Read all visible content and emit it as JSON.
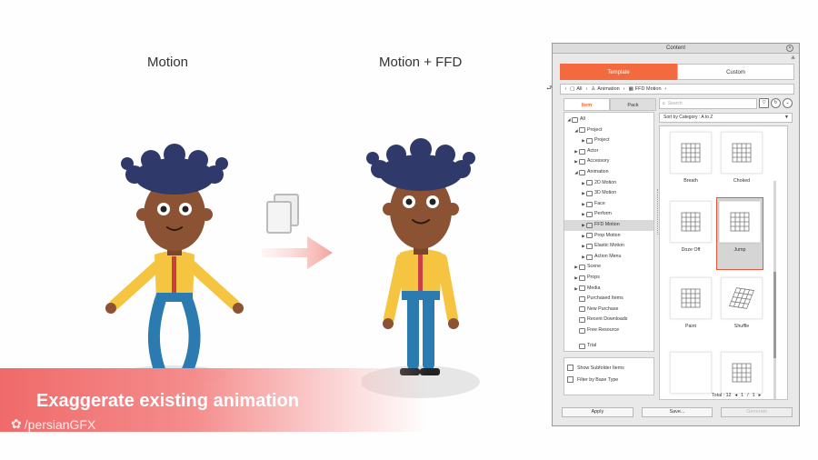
{
  "scene": {
    "caption_left": "Motion",
    "caption_right": "Motion + FFD",
    "banner_text": "Exaggerate existing animation",
    "watermark": "/persianGFX",
    "colors": {
      "accent": "#f26a3d",
      "banner": "#f06a6a",
      "shirt": "#f5c542",
      "pants": "#2b7bb0",
      "skin": "#8b5234",
      "hair": "#2f3a6b"
    }
  },
  "panel": {
    "title": "Content",
    "tabs": [
      "Template",
      "Custom"
    ],
    "active_tab": "Template",
    "breadcrumb": [
      "All",
      "Animation",
      "FFD Motion"
    ],
    "left_tabs": [
      "Item",
      "Pack"
    ],
    "tree": [
      {
        "label": "All",
        "level": 0,
        "toggle": "◢"
      },
      {
        "label": "Project",
        "level": 1,
        "toggle": "◢"
      },
      {
        "label": "Project",
        "level": 2,
        "toggle": "▶"
      },
      {
        "label": "Actor",
        "level": 1,
        "toggle": "▶"
      },
      {
        "label": "Accessory",
        "level": 1,
        "toggle": "▶"
      },
      {
        "label": "Animation",
        "level": 1,
        "toggle": "◢"
      },
      {
        "label": "2D Motion",
        "level": 2,
        "toggle": "▶"
      },
      {
        "label": "3D Motion",
        "level": 2,
        "toggle": "▶"
      },
      {
        "label": "Face",
        "level": 2,
        "toggle": "▶"
      },
      {
        "label": "Perform",
        "level": 2,
        "toggle": "▶"
      },
      {
        "label": "FFD Motion",
        "level": 2,
        "toggle": "▶",
        "selected": true
      },
      {
        "label": "Prop Motion",
        "level": 2,
        "toggle": "▶"
      },
      {
        "label": "Elastic Motion",
        "level": 2,
        "toggle": "▶"
      },
      {
        "label": "Action Menu",
        "level": 2,
        "toggle": "▶"
      },
      {
        "label": "Scene",
        "level": 1,
        "toggle": "▶"
      },
      {
        "label": "Props",
        "level": 1,
        "toggle": "▶"
      },
      {
        "label": "Media",
        "level": 1,
        "toggle": "▶"
      },
      {
        "label": "Purchased Items",
        "level": 1,
        "toggle": ""
      },
      {
        "label": "New Purchase",
        "level": 1,
        "toggle": ""
      },
      {
        "label": "Recent Downloads",
        "level": 1,
        "toggle": ""
      },
      {
        "label": "Free Resource",
        "level": 1,
        "toggle": ""
      },
      {
        "label": "",
        "level": 1,
        "toggle": ""
      },
      {
        "label": "Trial",
        "level": 1,
        "toggle": ""
      }
    ],
    "options": [
      "Show Subfolder Items",
      "Filter by Base Type"
    ],
    "search_placeholder": "Search",
    "sort_label": "Sort by Category : A to Z",
    "items": [
      "Breath",
      "Choked",
      "Doze Off",
      "Jump",
      "Paint",
      "Shuffle",
      "",
      ""
    ],
    "selected_item": "Jump",
    "total": "Total : 12",
    "page": "1",
    "page_sep": "/",
    "page_total": "1",
    "buttons": [
      "Apply",
      "Save...",
      "Generate"
    ]
  }
}
